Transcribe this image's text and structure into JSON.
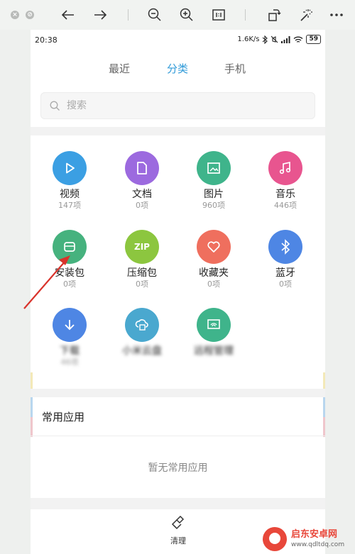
{
  "viewer": {
    "tools": [
      "close-icon",
      "minimize-icon",
      "back-arrow-icon",
      "forward-arrow-icon",
      "zoom-out-icon",
      "zoom-in-icon",
      "actual-size-icon",
      "rotate-icon",
      "magic-wand-icon",
      "more-icon"
    ]
  },
  "status_bar": {
    "time": "20:38",
    "network_speed": "1.6K/s",
    "battery": "59"
  },
  "tabs": [
    {
      "label": "最近",
      "active": false
    },
    {
      "label": "分类",
      "active": true
    },
    {
      "label": "手机",
      "active": false
    }
  ],
  "search": {
    "placeholder": "搜索"
  },
  "categories": [
    {
      "label": "视频",
      "count": "147项",
      "icon": "play-icon",
      "color": "#3b9fe3"
    },
    {
      "label": "文档",
      "count": "0项",
      "icon": "document-icon",
      "color": "#9c6adf"
    },
    {
      "label": "图片",
      "count": "960项",
      "icon": "image-icon",
      "color": "#3fb48b"
    },
    {
      "label": "音乐",
      "count": "446项",
      "icon": "music-icon",
      "color": "#e8558f"
    },
    {
      "label": "安装包",
      "count": "0项",
      "icon": "package-icon",
      "color": "#46b27e"
    },
    {
      "label": "压缩包",
      "count": "0项",
      "icon": "zip-icon",
      "color": "#8cc63f",
      "badge": "ZIP"
    },
    {
      "label": "收藏夹",
      "count": "0项",
      "icon": "heart-icon",
      "color": "#ef6f5e"
    },
    {
      "label": "蓝牙",
      "count": "0项",
      "icon": "bluetooth-icon",
      "color": "#4e86e4"
    },
    {
      "label": "下载",
      "count": "46项",
      "icon": "download-icon",
      "color": "#4e86e4",
      "blurred": true
    },
    {
      "label": "小米云盘",
      "count": "",
      "icon": "cloud-icon",
      "color": "#4aa8cf",
      "blurred": true
    },
    {
      "label": "远程管理",
      "count": "",
      "icon": "remote-icon",
      "color": "#3fb48b",
      "blurred": true
    }
  ],
  "frequent_apps": {
    "title": "常用应用",
    "empty_text": "暂无常用应用"
  },
  "bottom_bar": {
    "clean_label": "清理"
  },
  "watermark": {
    "name": "启东安卓网",
    "url": "www.qdltdq.com"
  }
}
